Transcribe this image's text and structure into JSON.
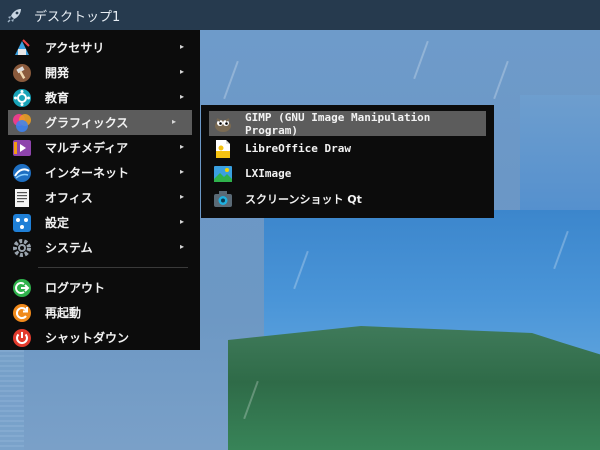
{
  "taskbar": {
    "title": "デスクトップ1",
    "launcher_icon": "rocket-icon"
  },
  "main_menu": {
    "items": [
      {
        "label": "アクセサリ",
        "icon": "accessories-icon",
        "has_submenu": true
      },
      {
        "label": "開発",
        "icon": "hammer-icon",
        "has_submenu": true
      },
      {
        "label": "教育",
        "icon": "education-icon",
        "has_submenu": true
      },
      {
        "label": "グラフィックス",
        "icon": "graphics-icon",
        "has_submenu": true,
        "selected": true
      },
      {
        "label": "マルチメディア",
        "icon": "multimedia-icon",
        "has_submenu": true
      },
      {
        "label": "インターネット",
        "icon": "internet-icon",
        "has_submenu": true
      },
      {
        "label": "オフィス",
        "icon": "office-icon",
        "has_submenu": true
      },
      {
        "label": "設定",
        "icon": "settings-icon",
        "has_submenu": true
      },
      {
        "label": "システム",
        "icon": "system-gear-icon",
        "has_submenu": true
      }
    ],
    "session": [
      {
        "label": "ログアウト",
        "icon": "logout-icon",
        "color": "#2fb24c"
      },
      {
        "label": "再起動",
        "icon": "reboot-icon",
        "color": "#f08a1c"
      },
      {
        "label": "シャットダウン",
        "icon": "power-icon",
        "color": "#e33b2e"
      }
    ],
    "arrow": "▸"
  },
  "sub_menu": {
    "items": [
      {
        "label": "GIMP (GNU Image Manipulation Program)",
        "icon": "gimp-icon",
        "selected": true
      },
      {
        "label": "LibreOffice Draw",
        "icon": "libreoffice-draw-icon"
      },
      {
        "label": "LXImage",
        "icon": "lximage-icon"
      },
      {
        "label": "スクリーンショット Qt",
        "icon": "screenshot-camera-icon"
      }
    ]
  },
  "colors": {
    "menu_bg": "#0c0c0c",
    "selection": "#5c5c5c",
    "taskbar": "#263a4e"
  }
}
